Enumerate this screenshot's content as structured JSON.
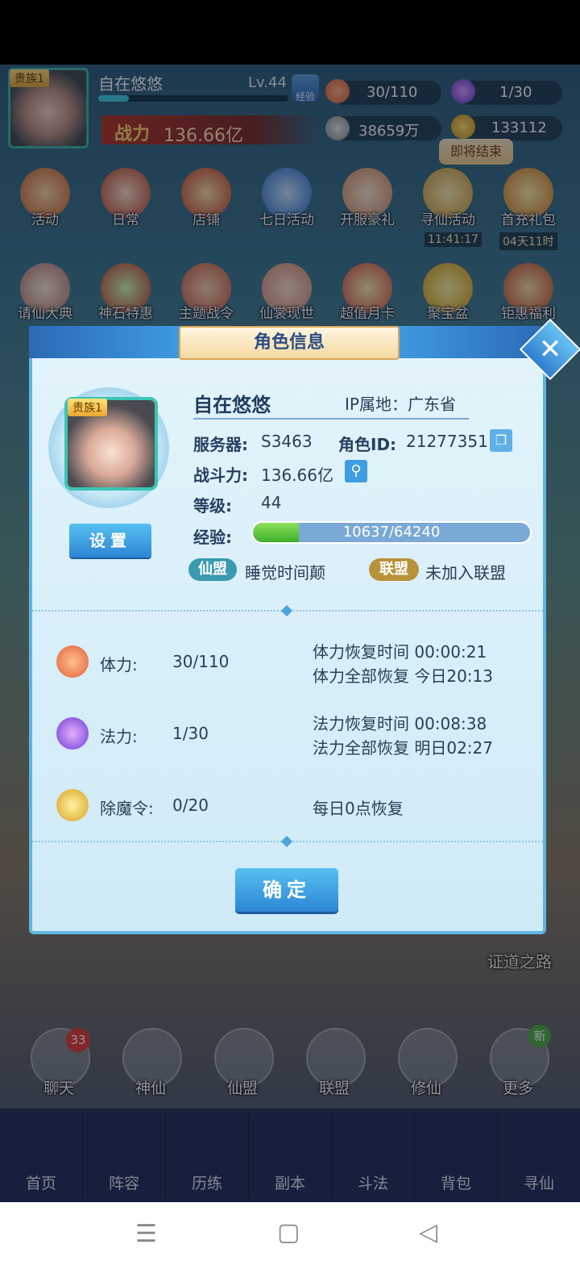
{
  "hud": {
    "rank_tag": "贵族1",
    "player_name": "自在悠悠",
    "level": "Lv.44",
    "exp_button": "经验",
    "exp_progress": 0.16,
    "power_label": "战力",
    "power_value": "136.66亿",
    "stamina": "30/110",
    "mana": "1/30",
    "silver": "38659万",
    "gold": "133112",
    "ending_tip": "即将结束"
  },
  "features_row1": [
    {
      "label": "活动",
      "timer": ""
    },
    {
      "label": "日常",
      "timer": ""
    },
    {
      "label": "店铺",
      "timer": ""
    },
    {
      "label": "七日活动",
      "timer": ""
    },
    {
      "label": "开服豪礼",
      "timer": ""
    },
    {
      "label": "寻仙活动",
      "timer": "11:41:17"
    },
    {
      "label": "首充礼包",
      "timer": "04天11时"
    }
  ],
  "features_row2": [
    {
      "label": "请仙大典"
    },
    {
      "label": "神石特惠"
    },
    {
      "label": "主题战令"
    },
    {
      "label": "仙裳现世"
    },
    {
      "label": "超值月卡"
    },
    {
      "label": "聚宝盆"
    },
    {
      "label": "钜惠福利"
    }
  ],
  "side": {
    "path_label": "证道之路"
  },
  "bottom_icons": [
    {
      "label": "聊天",
      "badge": "33"
    },
    {
      "label": "神仙",
      "badge": ""
    },
    {
      "label": "仙盟",
      "badge": ""
    },
    {
      "label": "联盟",
      "badge": ""
    },
    {
      "label": "修仙",
      "badge": ""
    },
    {
      "label": "更多",
      "badge": "新"
    }
  ],
  "nav": [
    {
      "label": "首页"
    },
    {
      "label": "阵容"
    },
    {
      "label": "历练"
    },
    {
      "label": "副本"
    },
    {
      "label": "斗法"
    },
    {
      "label": "背包"
    },
    {
      "label": "寻仙"
    }
  ],
  "dialog": {
    "title": "角色信息",
    "close": "✕",
    "rank_tag": "贵族1",
    "settings_label": "设置",
    "name": "自在悠悠",
    "ip_location": "IP属地：广东省",
    "server_label": "服务器:",
    "server_value": "S3463",
    "role_id_label": "角色ID:",
    "role_id_value": "21277351",
    "power_label": "战斗力:",
    "power_value": "136.66亿",
    "level_label": "等级:",
    "level_value": "44",
    "exp_label": "经验:",
    "exp_value": "10637/64240",
    "exp_progress": 0.166,
    "guild_tag": "仙盟",
    "guild_value": "睡觉时间颠",
    "alliance_tag": "联盟",
    "alliance_value": "未加入联盟",
    "stats": [
      {
        "label": "体力:",
        "value": "30/110",
        "note1": "体力恢复时间 00:00:21",
        "note2": "体力全部恢复 今日20:13"
      },
      {
        "label": "法力:",
        "value": "1/30",
        "note1": "法力恢复时间 00:08:38",
        "note2": "法力全部恢复 明日02:27"
      },
      {
        "label": "除魔令:",
        "value": "0/20",
        "note1": "每日0点恢复",
        "note2": ""
      }
    ],
    "confirm_label": "确定"
  },
  "system_nav": {
    "menu": "☰",
    "home": "▢",
    "back": "◁"
  }
}
